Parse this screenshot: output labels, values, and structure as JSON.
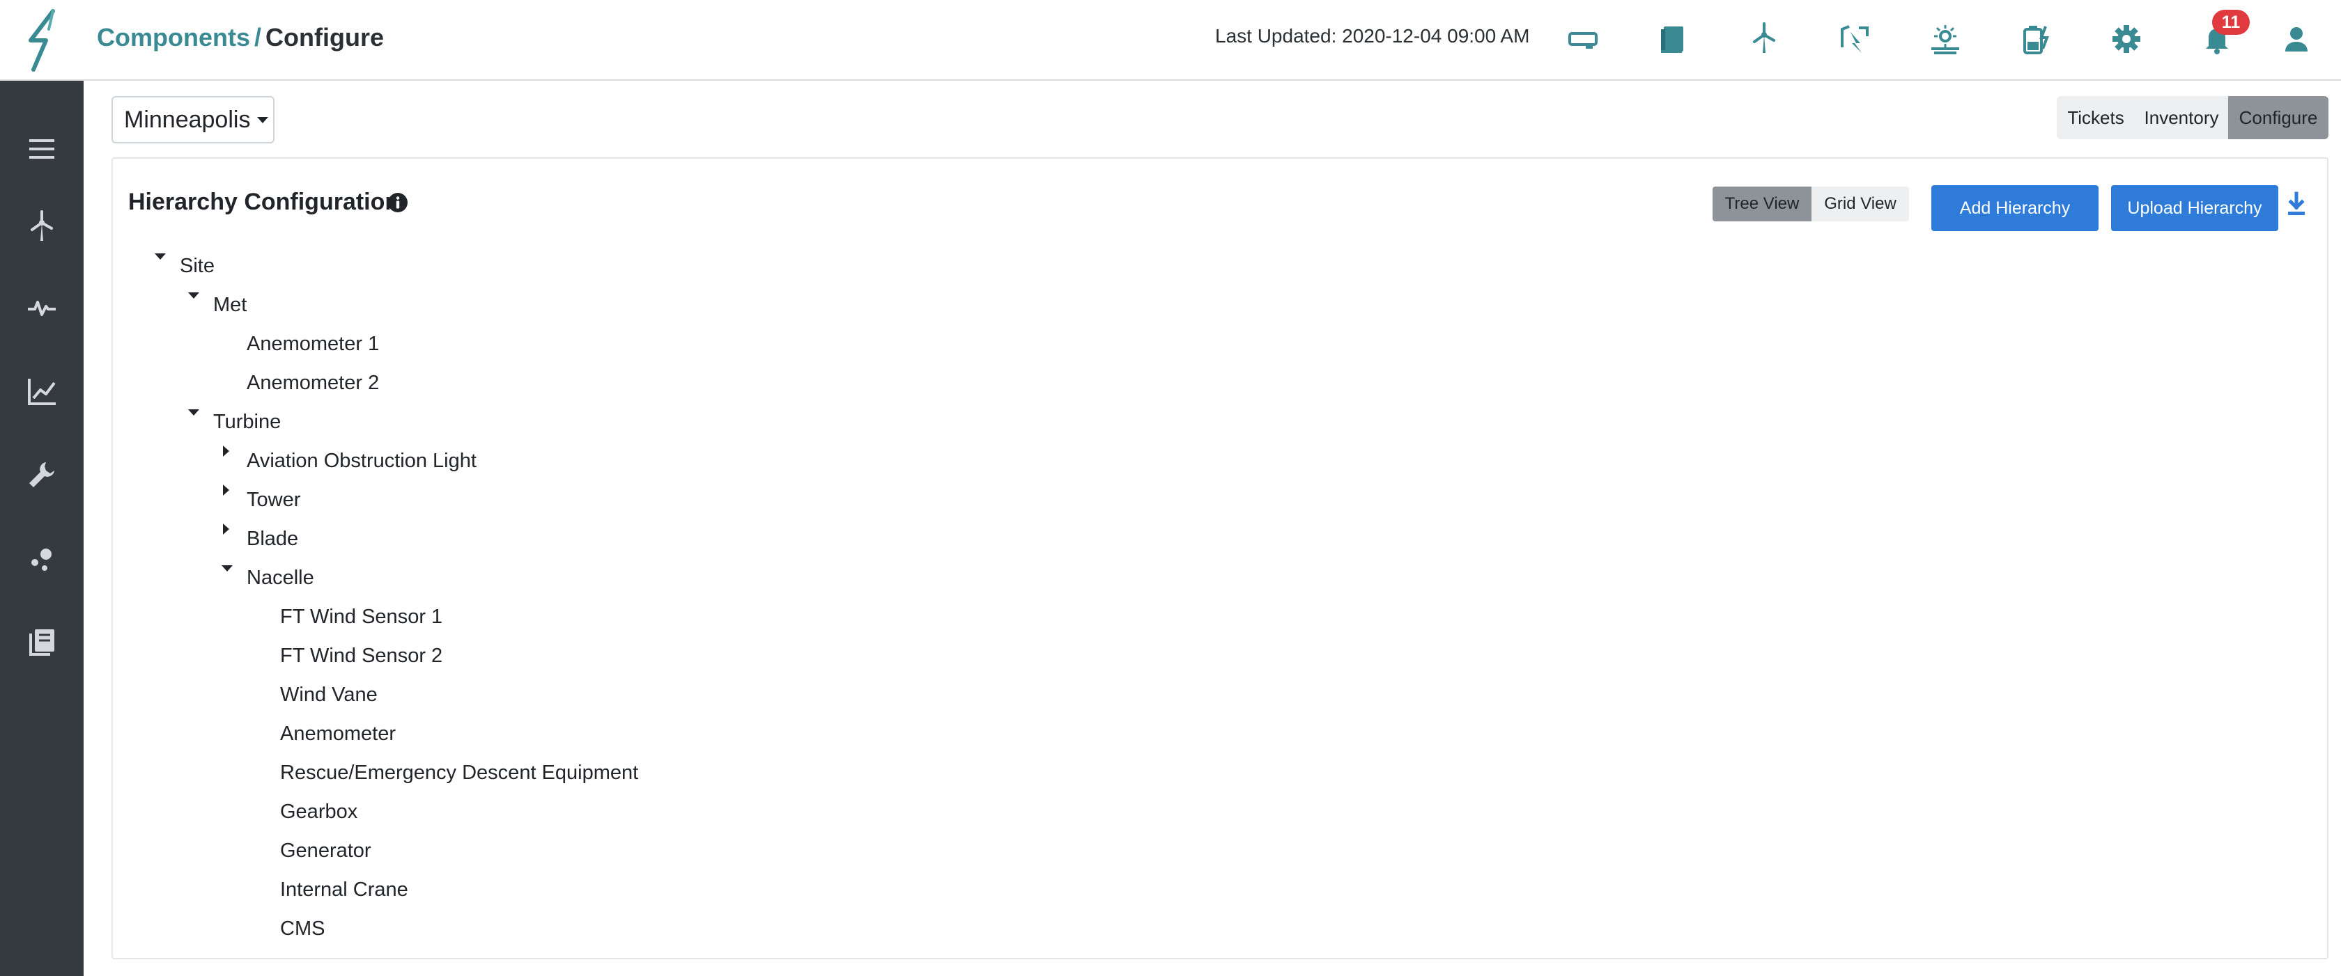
{
  "header": {
    "breadcrumb": {
      "link": "Components",
      "separator": "/",
      "current": "Configure"
    },
    "last_updated": "Last Updated: 2020-12-04 09:00 AM",
    "icons": [
      "drive-icon",
      "book-icon",
      "wind-turbine-icon",
      "lightning-map-icon",
      "solar-icon",
      "battery-charge-icon",
      "gear-icon",
      "bell-icon",
      "user-icon"
    ],
    "notification_count": "11",
    "accent_color": "#3a8a94"
  },
  "sidebar": {
    "items": [
      "menu-icon",
      "wind-turbine-icon",
      "pulse-icon",
      "line-chart-icon",
      "wrench-icon",
      "scatter-icon",
      "copy-icon"
    ],
    "background": "#343a40"
  },
  "site_select": {
    "value": "Minneapolis"
  },
  "top_tabs": [
    {
      "label": "Tickets",
      "active": false
    },
    {
      "label": "Inventory",
      "active": false
    },
    {
      "label": "Configure",
      "active": true
    }
  ],
  "card": {
    "title": "Hierarchy Configuration",
    "view_toggle": [
      {
        "label": "Tree View",
        "active": true
      },
      {
        "label": "Grid View",
        "active": false
      }
    ],
    "add_button": "Add Hierarchy",
    "upload_button": "Upload Hierarchy",
    "primary_color": "#2f7bd9"
  },
  "tree": [
    {
      "label": "Site",
      "level": 0,
      "toggle": "expanded"
    },
    {
      "label": "Met",
      "level": 1,
      "toggle": "expanded"
    },
    {
      "label": "Anemometer 1",
      "level": 2,
      "toggle": "none"
    },
    {
      "label": "Anemometer 2",
      "level": 2,
      "toggle": "none"
    },
    {
      "label": "Turbine",
      "level": 1,
      "toggle": "expanded"
    },
    {
      "label": "Aviation Obstruction Light",
      "level": 2,
      "toggle": "collapsed"
    },
    {
      "label": "Tower",
      "level": 2,
      "toggle": "collapsed"
    },
    {
      "label": "Blade",
      "level": 2,
      "toggle": "collapsed"
    },
    {
      "label": "Nacelle",
      "level": 2,
      "toggle": "expanded"
    },
    {
      "label": "FT Wind Sensor 1",
      "level": 3,
      "toggle": "none"
    },
    {
      "label": "FT Wind Sensor 2",
      "level": 3,
      "toggle": "none"
    },
    {
      "label": "Wind Vane",
      "level": 3,
      "toggle": "none"
    },
    {
      "label": "Anemometer",
      "level": 3,
      "toggle": "none"
    },
    {
      "label": "Rescue/Emergency Descent Equipment",
      "level": 3,
      "toggle": "none"
    },
    {
      "label": "Gearbox",
      "level": 3,
      "toggle": "none"
    },
    {
      "label": "Generator",
      "level": 3,
      "toggle": "none"
    },
    {
      "label": "Internal Crane",
      "level": 3,
      "toggle": "none"
    },
    {
      "label": "CMS",
      "level": 3,
      "toggle": "none"
    }
  ]
}
